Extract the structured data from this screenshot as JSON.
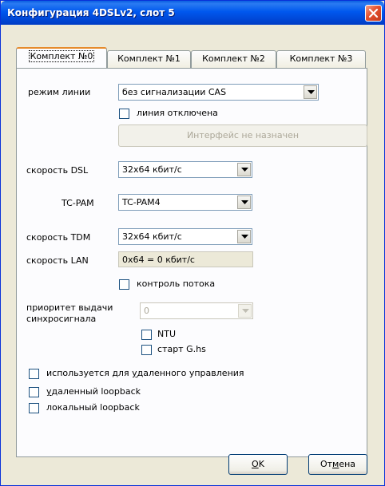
{
  "window": {
    "title": "Конфигурация 4DSLv2, слот 5"
  },
  "tabs": [
    {
      "label": "Комплект №0"
    },
    {
      "label": "Комплект №1"
    },
    {
      "label": "Комплект №2"
    },
    {
      "label": "Комплект №3"
    }
  ],
  "form": {
    "line_mode": {
      "label": "режим линии",
      "value": "без сигнализации CAS"
    },
    "line_disabled": {
      "label": "линия отключена"
    },
    "interface_button": {
      "label": "Интерфейс не назначен"
    },
    "dsl_speed": {
      "label": "скорость DSL",
      "value": "32x64 кбит/с"
    },
    "tc_pam": {
      "label": "TC-PAM",
      "value": "TC-PAM4"
    },
    "tdm_speed": {
      "label": "скорость TDM",
      "value": "32x64 кбит/с"
    },
    "lan_speed": {
      "label": "скорость LAN",
      "value": "0x64 = 0 кбит/с"
    },
    "flow_control": {
      "label": "контроль потока"
    },
    "sync_priority": {
      "label_line1": "приоритет выдачи",
      "label_line2": "синхросигнала",
      "value": "0"
    },
    "ntu": {
      "label": "NTU"
    },
    "start_ghs": {
      "label": "старт G.hs"
    },
    "remote_control": {
      "label_pre": "используется для ",
      "label_u": "у",
      "label_post": "даленного управления"
    },
    "remote_loopback": {
      "label_u": "у",
      "label_post": "даленный loopback"
    },
    "local_loopback": {
      "label": "локальный loopback"
    }
  },
  "buttons": {
    "ok": {
      "u": "O",
      "rest": "K"
    },
    "cancel": {
      "pre": "От",
      "u": "м",
      "post": "ена"
    }
  },
  "colors": {
    "titlebar": "#0058ee",
    "close": "#e4502e",
    "tab_highlight": "#e68b2c",
    "dialog_bg": "#ece9d8"
  }
}
